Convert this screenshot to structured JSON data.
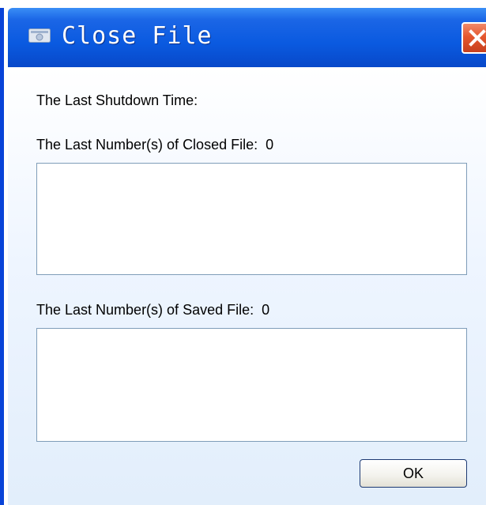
{
  "window": {
    "title": "Close File",
    "close_icon": "close-icon",
    "app_icon": "window-app-icon"
  },
  "content": {
    "shutdown_time_label": "The Last Shutdown Time:",
    "closed_files_label": "The Last Number(s) of Closed File:",
    "closed_files_count": "0",
    "closed_files_list_value": "",
    "saved_files_label": "The Last Number(s) of Saved File:",
    "saved_files_count": "0",
    "saved_files_list_value": ""
  },
  "buttons": {
    "ok_label": "OK"
  },
  "colors": {
    "titlebar": "#0a5ae0",
    "close_button": "#e5572e",
    "textbox_border": "#7f9db9"
  }
}
